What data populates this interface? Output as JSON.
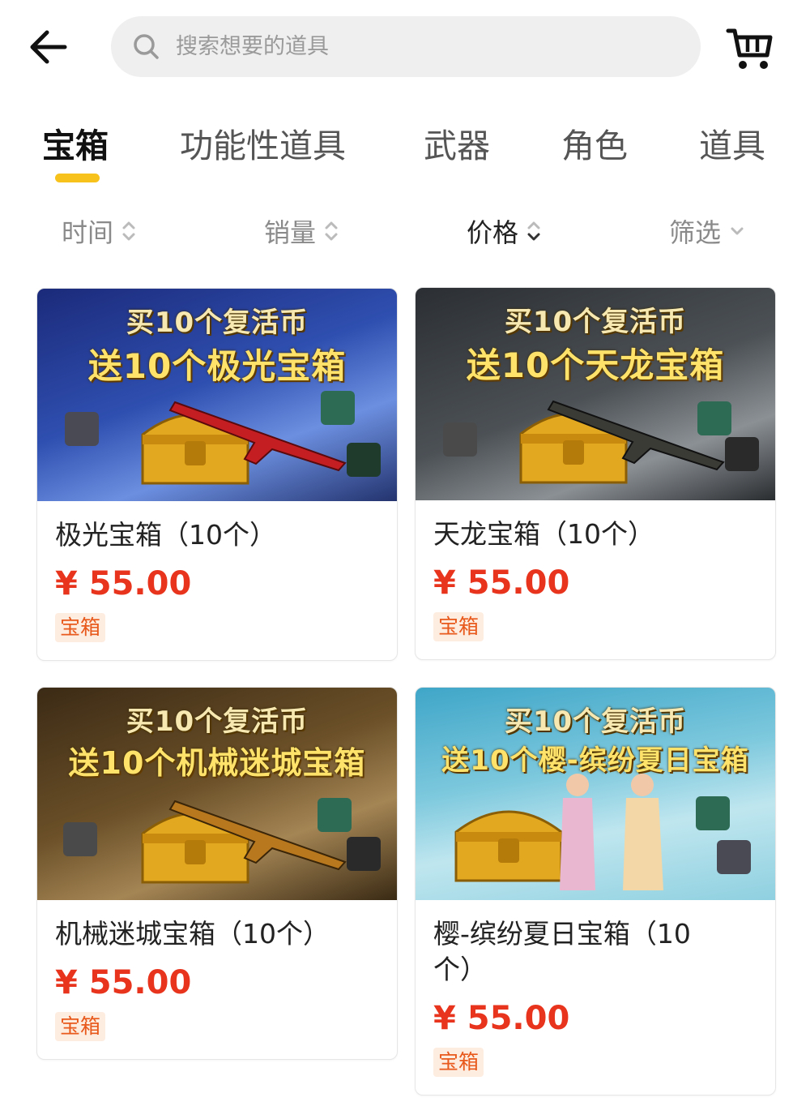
{
  "search": {
    "placeholder": "搜索想要的道具"
  },
  "tabs": [
    {
      "label": "宝箱",
      "active": true
    },
    {
      "label": "功能性道具"
    },
    {
      "label": "武器"
    },
    {
      "label": "角色"
    },
    {
      "label": "道具"
    }
  ],
  "sort": [
    {
      "label": "时间"
    },
    {
      "label": "销量"
    },
    {
      "label": "价格",
      "active": true
    },
    {
      "label": "筛选"
    }
  ],
  "products": [
    {
      "name": "极光宝箱（10个）",
      "price": "¥ 55.00",
      "tag": "宝箱",
      "banner": {
        "line1": "买10个复活币",
        "line2": "送10个极光宝箱",
        "bg": [
          "#1b2a7a",
          "#3a5fc8"
        ]
      }
    },
    {
      "name": "天龙宝箱（10个）",
      "price": "¥ 55.00",
      "tag": "宝箱",
      "banner": {
        "line1": "买10个复活币",
        "line2": "送10个天龙宝箱",
        "bg": [
          "#2b2f33",
          "#6b7077"
        ]
      }
    },
    {
      "name": "机械迷城宝箱（10个）",
      "price": "¥ 55.00",
      "tag": "宝箱",
      "banner": {
        "line1": "买10个复活币",
        "line2": "送10个机械迷城宝箱",
        "bg": [
          "#3b2a15",
          "#8a6a3a"
        ]
      }
    },
    {
      "name": "樱-缤纷夏日宝箱（10个）",
      "price": "¥ 55.00",
      "tag": "宝箱",
      "banner": {
        "line1": "买10个复活币",
        "line2": "送10个樱-缤纷夏日宝箱",
        "bg": [
          "#3fa6c8",
          "#bfe6ef"
        ]
      }
    }
  ],
  "colors": {
    "accent": "#f7c21b",
    "price": "#e8341c",
    "tag_text": "#e8591c",
    "tag_bg": "#fdece0"
  }
}
